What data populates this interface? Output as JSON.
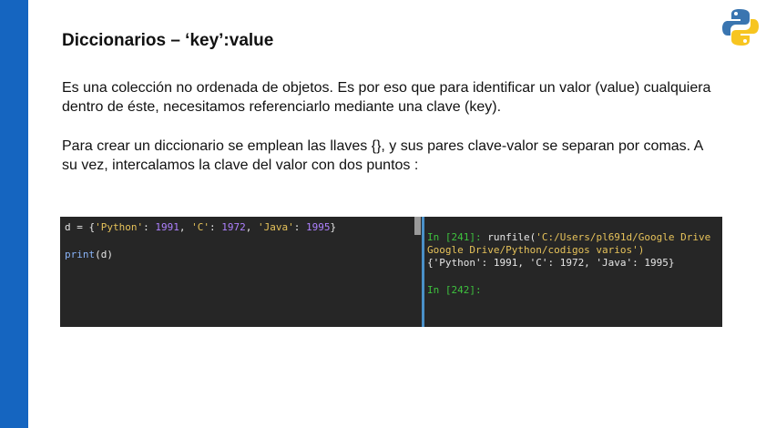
{
  "slide": {
    "title": "Diccionarios – ‘key’:value",
    "paragraph1": "Es una colección no ordenada de objetos. Es por eso que para identificar un valor (value) cualquiera dentro de éste, necesitamos referenciarlo mediante una clave (key).",
    "paragraph2": "Para crear un diccionario se emplean las llaves {}, y sus pares clave-valor se separan por comas. A su vez, intercalamos la clave del valor con dos puntos :",
    "logo_icon": "python-logo-icon"
  },
  "editor": {
    "line1": {
      "a": "d = {",
      "k1": "'Python'",
      "s1": ": ",
      "v1": "1991",
      "s2": ", ",
      "k2": "'C'",
      "s3": ": ",
      "v2": "1972",
      "s4": ", ",
      "k3": "'Java'",
      "s5": ": ",
      "v3": "1995",
      "b": "}"
    },
    "line2": {
      "fn": "print",
      "args": "(d)"
    }
  },
  "console": {
    "in1_prompt": "In [241]:",
    "in1_cmd": " runfile(",
    "in1_path": "'C:/Users/pl691d/Google Drive",
    "in1_cont": "Google Drive/Python/codigos varios')",
    "output": "{'Python': 1991, 'C': 1972, 'Java': 1995}",
    "in2_prompt": "In [242]:"
  },
  "colors": {
    "accent_bar": "#1565c0",
    "panel_bg": "#262626",
    "prompt_green": "#3ec23e",
    "string_yellow": "#e6c25a",
    "number_purple": "#ae81ff"
  }
}
